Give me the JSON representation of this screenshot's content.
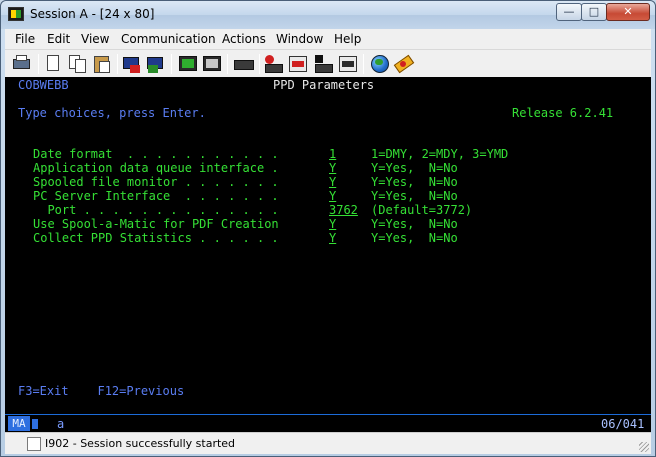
{
  "window": {
    "title": "Session A - [24 x 80]",
    "minimize": "—",
    "maximize": "□",
    "close": "✕"
  },
  "menu": [
    "File",
    "Edit",
    "View",
    "Communication",
    "Actions",
    "Window",
    "Help"
  ],
  "terminal": {
    "system": "COBWEBB",
    "title": "PPD Parameters",
    "instructions": "Type choices, press Enter.",
    "release": "Release 6.2.41",
    "rows": [
      {
        "label": "Date format  . . . . . . . . . . .",
        "value": "1",
        "hint": "1=DMY, 2=MDY, 3=YMD"
      },
      {
        "label": "Application data queue interface .",
        "value": "Y",
        "hint": "Y=Yes,  N=No"
      },
      {
        "label": "Spooled file monitor . . . . . . .",
        "value": "Y",
        "hint": "Y=Yes,  N=No"
      },
      {
        "label": "PC Server Interface  . . . . . . .",
        "value": "Y",
        "hint": "Y=Yes,  N=No"
      },
      {
        "label": "  Port . . . . . . . . . . . . . .",
        "value": "3762",
        "hint": "(Default=3772)"
      },
      {
        "label": "Use Spool-a-Matic for PDF Creation",
        "value": "Y",
        "hint": "Y=Yes,  N=No"
      },
      {
        "label": "Collect PPD Statistics . . . . . .",
        "value": "Y",
        "hint": "Y=Yes,  N=No"
      }
    ],
    "fkeys": "F3=Exit    F12=Previous"
  },
  "oia": {
    "mode": "MA",
    "indicator": "a",
    "position": "06/041"
  },
  "status": {
    "message": "I902 - Session successfully started"
  }
}
